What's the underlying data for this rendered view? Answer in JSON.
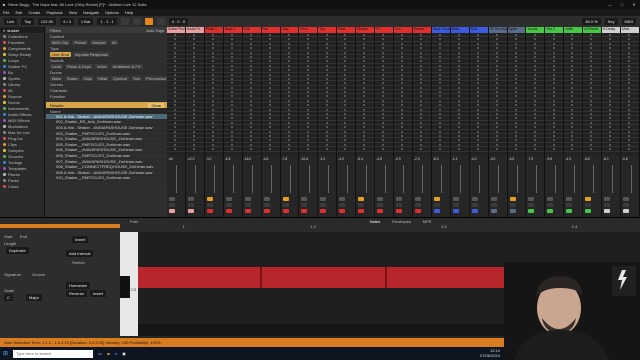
{
  "window": {
    "title": "Steve Bugg - The Hope feat. Ali Love (Olby Remix) [F]* - Ableton Live 12 Suite",
    "controls": [
      "—",
      "□",
      "✕"
    ]
  },
  "menu": [
    "File",
    "Edit",
    "Create",
    "Playback",
    "View",
    "Navigate",
    "Options",
    "Help"
  ],
  "transport": {
    "link": "Link",
    "tap": "Tap",
    "tempo": "122.00",
    "signature": "4 / 4",
    "quantize": "1 Bar",
    "position": "1 . 1 . 1",
    "position2": "4 . 0 . 0",
    "cpu": "48.0 %",
    "key": "Key",
    "midi": "MIDI"
  },
  "browser": {
    "search": "shaker",
    "filters_label": "Filters",
    "auto_tags": "Auto Tags",
    "places": [
      "Collections",
      "Favorites",
      "Components",
      "Setup Ready",
      "Loops",
      "Shaker FX",
      "Ba",
      "Synths",
      "Library",
      "All",
      "Sounds",
      "Drums",
      "Instruments",
      "Audio Effects",
      "MIDI Effects",
      "Modulators",
      "Max for Live",
      "Plug-Ins",
      "Clips",
      "Samples",
      "Grooves",
      "Tunings",
      "Templates",
      "Places",
      "Packs",
      "Cloud"
    ],
    "content_label": "Content",
    "content_opts": [
      "MIDI Clip",
      "Preset",
      "Sample",
      "Kit"
    ],
    "type_label": "Type",
    "type_opts": [
      "One Shot",
      "Impulse Response"
    ],
    "sounds_label": "Sounds",
    "sounds_opts": [
      "Lead",
      "Piano & Keys",
      "Voice",
      "Ambience & FX"
    ],
    "drums_label": "Drums",
    "drums_opts": [
      "Bass",
      "Snare",
      "Clap",
      "Hihat",
      "Cymbal",
      "Tom",
      "Percussion"
    ],
    "genres_label": "Genres",
    "character_label": "Character",
    "function_label": "Function",
    "results_label": "Results",
    "clear_label": "Clear",
    "name_header": "Name",
    "files": [
      "001 A-Hat - Shaker - AVAVAPASHOUSE Zorhinan.wav",
      "002_Shaker_RS_Arts_Zorhinan.wav",
      "003 A-Hat - Shaker - AVAVAPASHOUSE Zorhinan.wav",
      "003_Shaker__PARTICLES_Zorhinan.wav",
      "004_Shaker__AVAVAPASHOUSE_Zorhinan.wav",
      "005_Shaker__PARTICLES_Zorhinan.wav",
      "006_Shaker__AVAVAPASHOUSE_Zorhinan.wav",
      "006_Shaker__PARTICLES_Zorhinan.wav",
      "007_Shaker__AVAVAPASHOUSE_Zorhinan.wav",
      "008_Shaker__CONNECTFREQHOUSE_Zorhinan.wav",
      "008 A-Hat - Shaker - AVAVAPASHOUSE Zorhinan.wav",
      "010_Shaker__PARTICLES_Zorhinan.wav"
    ]
  },
  "tracks": [
    {
      "name": "Guitar Pluck",
      "color": "#e8a0a0"
    },
    {
      "name": "Audio Fx",
      "color": "#e8a0a0"
    },
    {
      "name": "Pluck 1",
      "color": "#e0302e"
    },
    {
      "name": "Bass 1",
      "color": "#e0302e"
    },
    {
      "name": "Kick",
      "color": "#e0302e"
    },
    {
      "name": "Hat",
      "color": "#e0302e"
    },
    {
      "name": "Clap",
      "color": "#e0302e"
    },
    {
      "name": "Perc",
      "color": "#e0302e"
    },
    {
      "name": "Top",
      "color": "#e0302e"
    },
    {
      "name": "Ride",
      "color": "#e0302e"
    },
    {
      "name": "Shaker",
      "color": "#e0302e"
    },
    {
      "name": "FX",
      "color": "#e0302e"
    },
    {
      "name": "Vox",
      "color": "#e0302e"
    },
    {
      "name": "Return",
      "color": "#e0302e"
    },
    {
      "name": "Bass Group",
      "color": "#3d5be0"
    },
    {
      "name": "Bass",
      "color": "#3d5be0"
    },
    {
      "name": "Sub",
      "color": "#3d5be0"
    },
    {
      "name": "30 The Hook",
      "color": "#5a6a8a"
    },
    {
      "name": "Synth",
      "color": "#5a6a8a"
    },
    {
      "name": "Vocals",
      "color": "#46c846"
    },
    {
      "name": "Vox 2",
      "color": "#46c846"
    },
    {
      "name": "Adlib",
      "color": "#46c846"
    },
    {
      "name": "A Reverb",
      "color": "#46c846"
    },
    {
      "name": "B Delay",
      "color": "#cfcfcf"
    },
    {
      "name": "Main",
      "color": "#cfcfcf"
    }
  ],
  "mixer_values": [
    "-inf",
    "-12.0",
    "-3.2",
    "-6.5",
    "-16.0",
    "-4.8",
    "-7.8",
    "-10.6",
    "-3.4",
    "-4.0",
    "-5.4",
    "-4.5",
    "-0.9",
    "-2.3",
    "-6.0",
    "-1.2",
    "-4.0",
    "-3.0",
    "-5.5",
    "-7.5",
    "-9.6",
    "-4.9",
    "-6.6",
    "-8.1",
    "-0.8"
  ],
  "detail_tabs": [
    "Fold",
    "Notes",
    "Envelopes",
    "MPE"
  ],
  "detail": {
    "start": "Start",
    "end": "End",
    "length": "Length",
    "signature": "Signature",
    "groove": "Groove",
    "scale": "Scale",
    "scale_value": "C",
    "scale_mode": "Major",
    "duplicate": "Duplicate",
    "insert": "Insert",
    "add_interval": "Add Interval",
    "stretch": "Stretch",
    "humanize": "Humanize",
    "reverse": "Reverse",
    "invert": "Invert",
    "velocity": "Velocity",
    "randomize": "Randomize",
    "ramp": "Ramp",
    "deviation": "Deviation",
    "pitch_label": "C3",
    "ruler": [
      "1",
      "1.2",
      "1.3",
      "1.4"
    ]
  },
  "status": "Note Selection  Time: 1.1.1 - 1.4.4.23  (Duration: 0.3.3.23)  Velocity: 100  Probability: 100%",
  "taskbar": {
    "search_placeholder": "Type here to search",
    "time": "12:10",
    "date": "07/06/2024"
  },
  "accent": "#d97b1f"
}
